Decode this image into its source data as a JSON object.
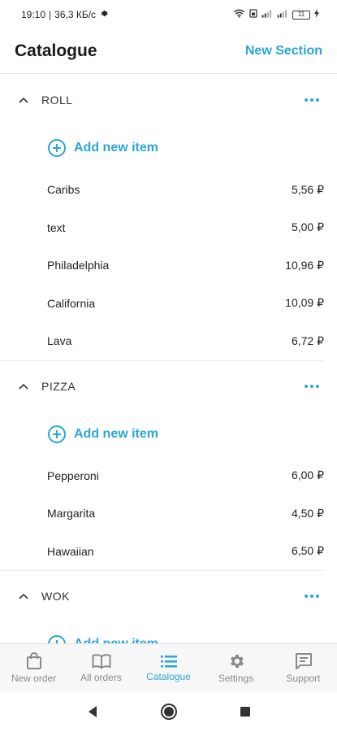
{
  "status_bar": {
    "time": "19:10",
    "separator": "|",
    "speed": "36,3 КБ/с",
    "battery": "11"
  },
  "header": {
    "title": "Catalogue",
    "action": "New Section"
  },
  "add_item_label": "Add new item",
  "sections": [
    {
      "name": "ROLL",
      "items": [
        {
          "name": "Caribs",
          "price": "5,56 ₽"
        },
        {
          "name": "text",
          "price": "5,00 ₽"
        },
        {
          "name": "Philadelphia",
          "price": "10,96 ₽"
        },
        {
          "name": "California",
          "price": "10,09 ₽"
        },
        {
          "name": "Lava",
          "price": "6,72 ₽"
        }
      ]
    },
    {
      "name": "PIZZA",
      "items": [
        {
          "name": "Pepperoni",
          "price": "6,00 ₽"
        },
        {
          "name": "Margarita",
          "price": "4,50 ₽"
        },
        {
          "name": "Hawaiian",
          "price": "6,50 ₽"
        }
      ]
    },
    {
      "name": "WOK",
      "items": []
    }
  ],
  "bottom_nav": [
    {
      "label": "New order",
      "icon": "shopping-bag-icon"
    },
    {
      "label": "All orders",
      "icon": "open-book-icon"
    },
    {
      "label": "Catalogue",
      "icon": "list-icon",
      "active": true
    },
    {
      "label": "Settings",
      "icon": "gear-icon"
    },
    {
      "label": "Support",
      "icon": "chat-icon"
    }
  ],
  "colors": {
    "accent": "#2ba6d6",
    "inactive": "#8a8a8a",
    "text": "#1a1a1a"
  }
}
